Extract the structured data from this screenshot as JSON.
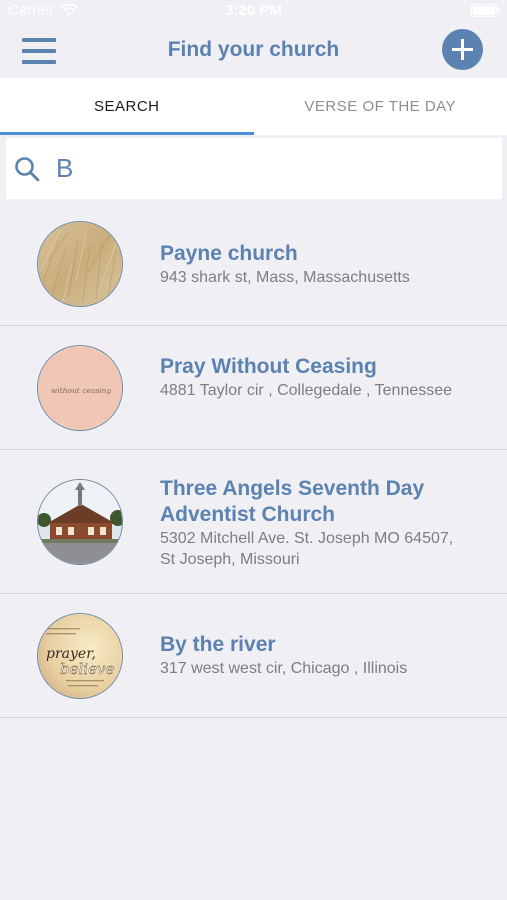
{
  "status_bar": {
    "carrier": "Carrier",
    "time": "3:20 PM"
  },
  "nav": {
    "title": "Find your church"
  },
  "tabs": [
    {
      "label": "SEARCH",
      "active": true
    },
    {
      "label": "VERSE OF THE DAY",
      "active": false
    }
  ],
  "search": {
    "value": "B"
  },
  "churches": [
    {
      "name": "Payne church",
      "address": "943 shark st, Mass, Massachusetts",
      "avatar": "wheat-field-photo"
    },
    {
      "name": "Pray Without Ceasing",
      "address": "4881 Taylor cir , Collegedale , Tennessee",
      "avatar": "without-ceasing-pink-graphic",
      "avatar_text": "without ceasing"
    },
    {
      "name": "Three Angels Seventh Day Adventist Church",
      "address": "5302 Mitchell Ave. St. Joseph MO 64507, St Joseph, Missouri",
      "avatar": "church-building-photo"
    },
    {
      "name": "By the river",
      "address": "317 west west cir, Chicago , Illinois",
      "avatar": "prayer-believe-graphic",
      "avatar_text": [
        "prayer,",
        "believe"
      ]
    }
  ],
  "colors": {
    "accent": "#5b82b0",
    "tab_indicator": "#4a90d9",
    "background": "#efeff4"
  }
}
